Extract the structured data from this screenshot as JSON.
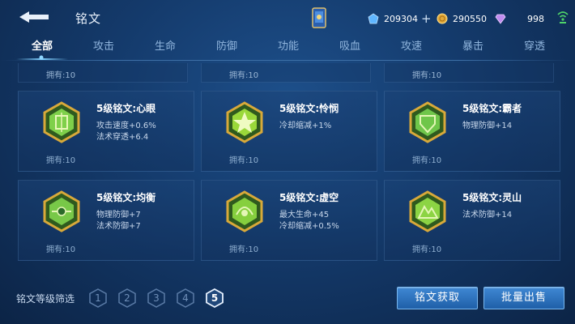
{
  "header": {
    "title": "铭文",
    "currencies": [
      {
        "icon": "crystal-icon",
        "value": "209304"
      },
      {
        "icon": "gold-coin-icon",
        "value": "290550"
      },
      {
        "icon": "diamond-icon",
        "value": "998"
      }
    ]
  },
  "tabs": [
    "全部",
    "攻击",
    "生命",
    "防御",
    "功能",
    "吸血",
    "攻速",
    "暴击",
    "穿透"
  ],
  "active_tab": 0,
  "top_row": [
    "拥有:10",
    "拥有:10",
    "拥有:10"
  ],
  "cards": [
    {
      "name": "5级铭文:心眼",
      "attrs": [
        "攻击速度+0.6%",
        "法术穿透+6.4"
      ],
      "owned": "拥有:10",
      "color": "#7ed04a",
      "icon": "sparkle-emblem-icon"
    },
    {
      "name": "5级铭文:怜悯",
      "attrs": [
        "冷却缩减+1%"
      ],
      "owned": "拥有:10",
      "color": "#9ad83a",
      "icon": "star-emblem-icon"
    },
    {
      "name": "5级铭文:霸者",
      "attrs": [
        "物理防御+14"
      ],
      "owned": "拥有:10",
      "color": "#6fc64a",
      "icon": "shield-emblem-icon"
    },
    {
      "name": "5级铭文:均衡",
      "attrs": [
        "物理防御+7",
        "法术防御+7"
      ],
      "owned": "拥有:10",
      "color": "#78c848",
      "icon": "balance-emblem-icon"
    },
    {
      "name": "5级铭文:虚空",
      "attrs": [
        "最大生命+45",
        "冷却缩减+0.5%"
      ],
      "owned": "拥有:10",
      "color": "#86cf3e",
      "icon": "void-emblem-icon"
    },
    {
      "name": "5级铭文:灵山",
      "attrs": [
        "法术防御+14"
      ],
      "owned": "拥有:10",
      "color": "#8cd444",
      "icon": "mountain-emblem-icon"
    }
  ],
  "footer": {
    "filter_label": "铭文等级筛选",
    "levels": [
      "1",
      "2",
      "3",
      "4",
      "5"
    ],
    "active_level": "5",
    "buttons": {
      "acquire": "铭文获取",
      "sell": "批量出售"
    }
  },
  "colors": {
    "accent": "#3f88d3",
    "gem_border": "#d8a93a"
  }
}
